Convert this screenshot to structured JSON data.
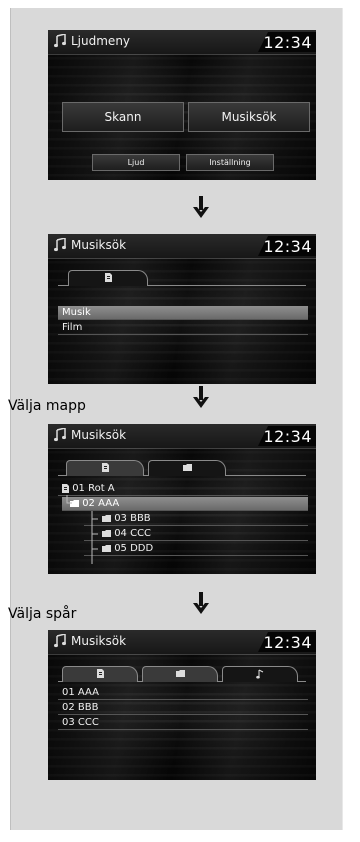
{
  "screens": [
    {
      "title": "Ljudmeny",
      "time": "12:34",
      "buttons": [
        "Skann",
        "Musiksök"
      ],
      "bottom_buttons": [
        "Ljud",
        "Inställning"
      ]
    },
    {
      "title": "Musiksök",
      "time": "12:34",
      "tab_icons": [
        "sd-card-icon"
      ],
      "items": [
        "Musik",
        "Film"
      ],
      "selected_index": 0
    },
    {
      "section_label": "Välja mapp",
      "title": "Musiksök",
      "time": "12:34",
      "tab_icons": [
        "sd-card-icon",
        "folder-icon"
      ],
      "items": [
        "01 Rot A",
        "02 AAA",
        "03 BBB",
        "04 CCC",
        "05 DDD"
      ],
      "selected_index": 1
    },
    {
      "section_label": "Välja spår",
      "title": "Musiksök",
      "time": "12:34",
      "tab_icons": [
        "sd-card-icon",
        "folder-icon",
        "music-note-icon"
      ],
      "items": [
        "01 AAA",
        "02 BBB",
        "03 CCC"
      ]
    }
  ],
  "colors": {
    "screen_bg": "#111111",
    "highlight": "#7f7f7f",
    "frame": "#d9d9d9"
  }
}
